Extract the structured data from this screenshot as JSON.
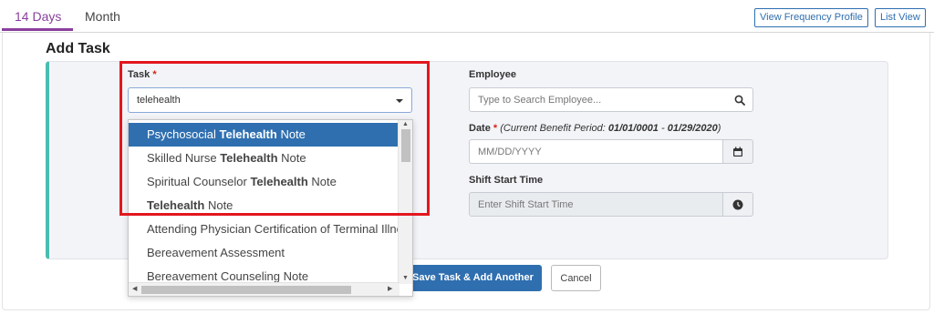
{
  "tabs": [
    {
      "label": "14 Days",
      "active": true
    },
    {
      "label": "Month",
      "active": false
    }
  ],
  "top_buttons": {
    "frequency_profile": "View Frequency Profile",
    "list_view": "List View"
  },
  "section_title": "Add Task",
  "task": {
    "label": "Task",
    "required_mark": "*",
    "value": "telehealth",
    "options": [
      {
        "prefix": "Psychosocial ",
        "match": "Telehealth",
        "suffix": " Note",
        "selected": true
      },
      {
        "prefix": "Skilled Nurse ",
        "match": "Telehealth",
        "suffix": " Note",
        "selected": false
      },
      {
        "prefix": "Spiritual Counselor ",
        "match": "Telehealth",
        "suffix": " Note",
        "selected": false
      },
      {
        "prefix": "",
        "match": "Telehealth",
        "suffix": " Note",
        "selected": false
      },
      {
        "prefix": "Attending Physician Certification of Terminal Illness",
        "match": "",
        "suffix": "",
        "selected": false
      },
      {
        "prefix": "Bereavement Assessment",
        "match": "",
        "suffix": "",
        "selected": false
      },
      {
        "prefix": "Bereavement Counseling Note",
        "match": "",
        "suffix": "",
        "selected": false
      }
    ]
  },
  "employee": {
    "label": "Employee",
    "placeholder": "Type to Search Employee..."
  },
  "date": {
    "label": "Date",
    "required_mark": "*",
    "hint_prefix": "(Current Benefit Period: ",
    "hint_start": "01/01/0001",
    "hint_sep": " - ",
    "hint_end": "01/29/2020",
    "hint_suffix": ")",
    "placeholder": "MM/DD/YYYY"
  },
  "shift_start": {
    "label": "Shift Start Time",
    "placeholder": "Enter Shift Start Time"
  },
  "actions": {
    "save_add_another": "Save Task & Add Another",
    "cancel": "Cancel"
  },
  "colors": {
    "accent_tab": "#8a3f9c",
    "primary": "#2f6fb0",
    "card_stripe": "#4bbdb0",
    "highlight": "#e3161e"
  },
  "icons": {
    "search": "search-icon",
    "calendar": "calendar-icon",
    "clock": "clock-icon"
  }
}
